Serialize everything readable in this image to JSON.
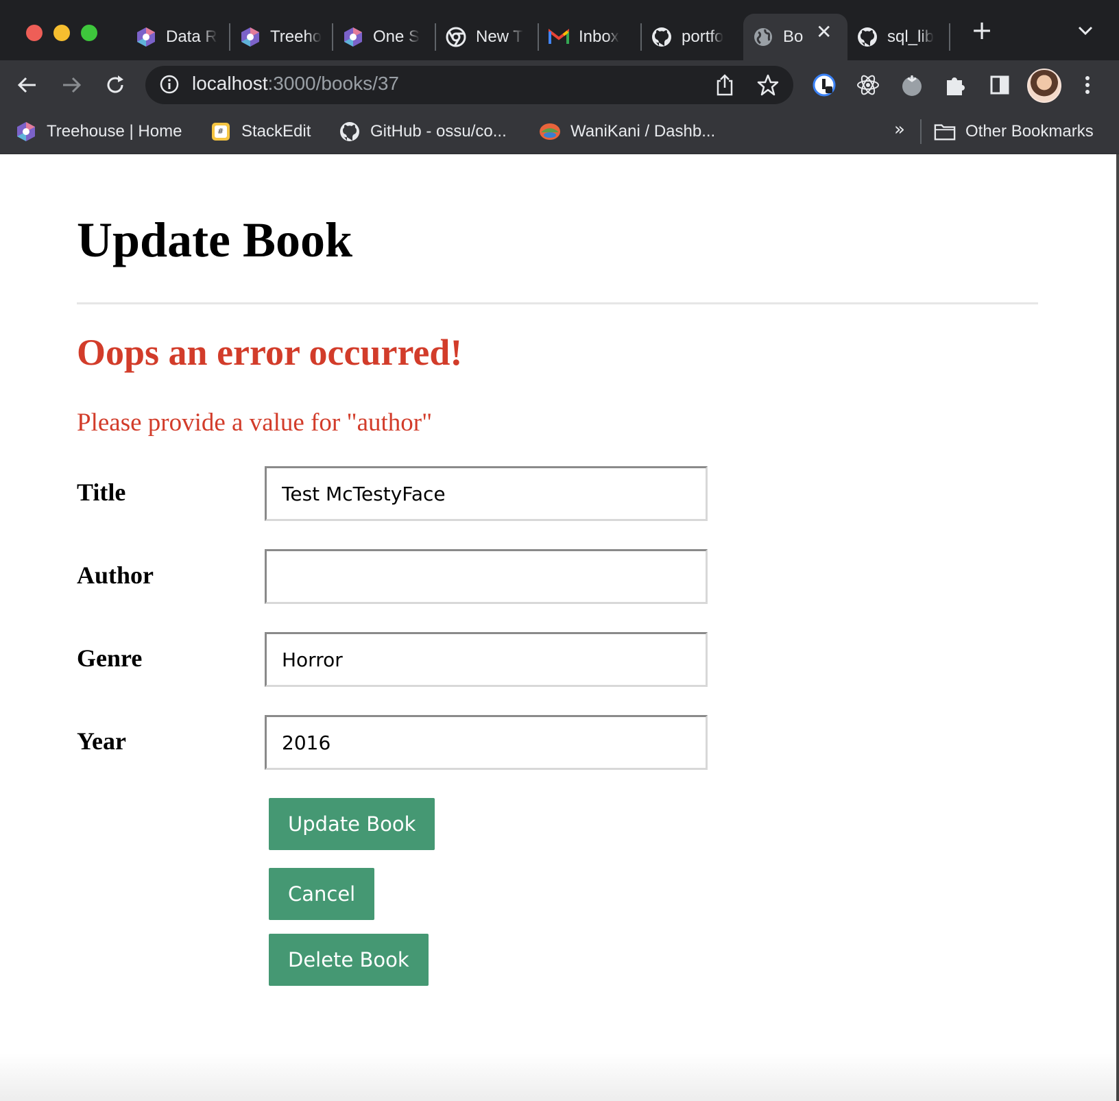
{
  "browser": {
    "tabs": [
      {
        "label": "Data R",
        "icon": "treehouse-icon"
      },
      {
        "label": "Treeho",
        "icon": "treehouse-icon"
      },
      {
        "label": "One S",
        "icon": "treehouse-icon"
      },
      {
        "label": "New T",
        "icon": "chrome-icon"
      },
      {
        "label": "Inbox",
        "icon": "gmail-icon"
      },
      {
        "label": "portfo",
        "icon": "github-icon"
      },
      {
        "label": "Bo",
        "icon": "globe-icon",
        "active": true
      },
      {
        "label": "sql_lib",
        "icon": "github-icon"
      }
    ],
    "url_host": "localhost",
    "url_path": ":3000/books/37",
    "bookmarks": [
      {
        "label": "Treehouse | Home",
        "icon": "treehouse-icon"
      },
      {
        "label": "StackEdit",
        "icon": "stackedit-icon"
      },
      {
        "label": "GitHub - ossu/co...",
        "icon": "github-icon"
      },
      {
        "label": "WaniKani / Dashb...",
        "icon": "wanikani-icon"
      }
    ],
    "more_bookmarks": "»",
    "other_bookmarks": "Other Bookmarks"
  },
  "page": {
    "title": "Update Book",
    "error_title": "Oops an error occurred!",
    "error_message": "Please provide a value for \"author\"",
    "fields": [
      {
        "label": "Title",
        "value": "Test McTestyFace"
      },
      {
        "label": "Author",
        "value": ""
      },
      {
        "label": "Genre",
        "value": "Horror"
      },
      {
        "label": "Year",
        "value": "2016"
      }
    ],
    "buttons": {
      "update": "Update Book",
      "cancel": "Cancel",
      "delete": "Delete Book"
    }
  },
  "colors": {
    "error": "#d23c2a",
    "button": "#459873",
    "chrome_dark": "#35363a",
    "tabstrip": "#1f2023"
  }
}
